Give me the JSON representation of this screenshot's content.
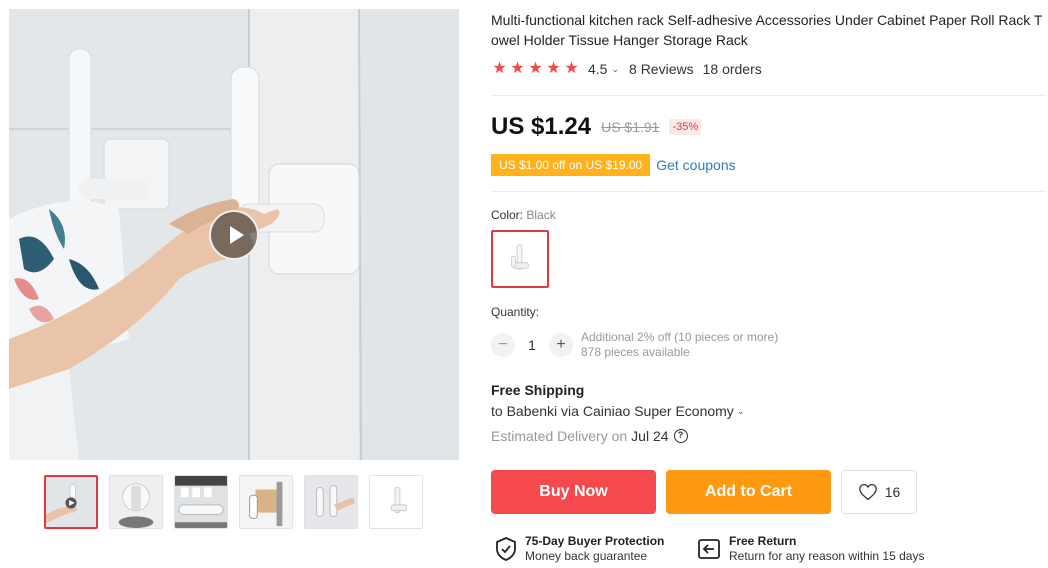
{
  "product": {
    "title": "Multi-functional kitchen rack Self-adhesive Accessories Under Cabinet Paper Roll Rack Towel Holder Tissue Hanger Storage Rack",
    "rating": "4.5",
    "reviews": "8 Reviews",
    "orders": "18 orders"
  },
  "price": {
    "current": "US $1.24",
    "original": "US $1.91",
    "discount": "-35%"
  },
  "coupon": {
    "badge": "US $1.00 off on US $19.00",
    "link": "Get coupons"
  },
  "color": {
    "label": "Color:",
    "selected": "Black"
  },
  "quantity": {
    "label": "Quantity:",
    "minus": "−",
    "plus": "+",
    "value": "1",
    "additional": "Additional 2% off (10 pieces or more)",
    "available": "878 pieces available"
  },
  "shipping": {
    "title": "Free Shipping",
    "to": "to Babenki via Cainiao Super Economy",
    "estimated_label": "Estimated Delivery on",
    "estimated_date": "Jul 24"
  },
  "actions": {
    "buy_now": "Buy Now",
    "add_to_cart": "Add to Cart",
    "wishlist_count": "16"
  },
  "guarantees": [
    {
      "title": "75-Day Buyer Protection",
      "subtitle": "Money back guarantee"
    },
    {
      "title": "Free Return",
      "subtitle": "Return for any reason within 15 days"
    }
  ],
  "icons": {
    "star": "★",
    "chevron": "⌄",
    "help": "?"
  },
  "colors": {
    "accent_red": "#f4494d",
    "cart_orange": "#ff9a10",
    "coupon_yellow": "#ffb21c",
    "link_blue": "#2e7bbd",
    "star_red": "#f24949"
  }
}
